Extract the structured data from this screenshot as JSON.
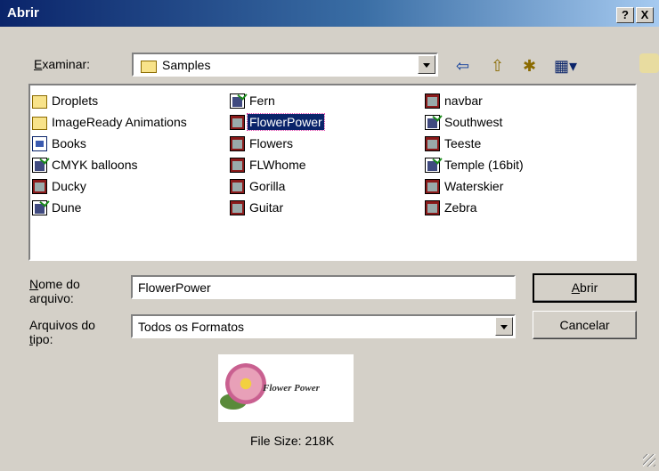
{
  "window": {
    "title": "Abrir",
    "help_label": "?",
    "close_label": "X"
  },
  "look_in": {
    "label_u": "E",
    "label_rest": "xaminar:",
    "value": "Samples"
  },
  "toolbar": {
    "back_icon": "⇦",
    "up_icon": "⇧",
    "new_folder_icon": "✱",
    "view_icon": "▦▾"
  },
  "files": [
    {
      "name": "Droplets",
      "icon": "folder-icon"
    },
    {
      "name": "ImageReady Animations",
      "icon": "folder-icon"
    },
    {
      "name": "Books",
      "icon": "books-icon"
    },
    {
      "name": "CMYK balloons",
      "icon": "psd-icon"
    },
    {
      "name": "Ducky",
      "icon": "image-icon"
    },
    {
      "name": "Dune",
      "icon": "psd-icon"
    },
    {
      "name": "Fern",
      "icon": "psd-icon"
    },
    {
      "name": "FlowerPower",
      "icon": "image-icon",
      "selected": true
    },
    {
      "name": "Flowers",
      "icon": "image-icon"
    },
    {
      "name": "FLWhome",
      "icon": "image-icon"
    },
    {
      "name": "Gorilla",
      "icon": "image-icon"
    },
    {
      "name": "Guitar",
      "icon": "image-icon"
    },
    {
      "name": "navbar",
      "icon": "image-icon"
    },
    {
      "name": "Southwest",
      "icon": "psd-icon"
    },
    {
      "name": "Teeste",
      "icon": "image-icon"
    },
    {
      "name": "Temple (16bit)",
      "icon": "psd-icon"
    },
    {
      "name": "Waterskier",
      "icon": "image-icon"
    },
    {
      "name": "Zebra",
      "icon": "image-icon"
    }
  ],
  "filename": {
    "label_u": "N",
    "label_rest": "ome do",
    "label_line2": "arquivo:",
    "value": "FlowerPower"
  },
  "filetype": {
    "label_line1": "Arquivos do",
    "label_u": "t",
    "label_rest": "ipo:",
    "value": "Todos os Formatos"
  },
  "buttons": {
    "open_u": "A",
    "open_rest": "brir",
    "cancel": "Cancelar"
  },
  "preview": {
    "caption": "Flower Power",
    "file_size": "File Size:  218K"
  }
}
